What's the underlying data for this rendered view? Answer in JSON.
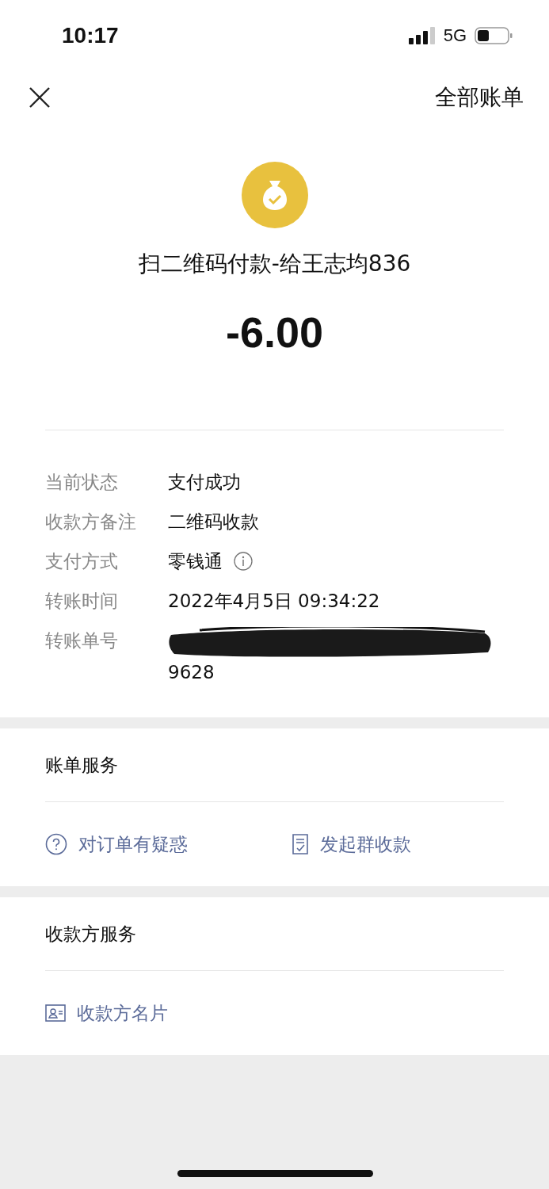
{
  "status_bar": {
    "time": "10:17",
    "network": "5G"
  },
  "nav": {
    "right_link": "全部账单"
  },
  "payment": {
    "title": "扫二维码付款-给王志均836",
    "amount": "-6.00"
  },
  "details": [
    {
      "label": "当前状态",
      "value": "支付成功",
      "kind": "text"
    },
    {
      "label": "收款方备注",
      "value": "二维码收款",
      "kind": "text"
    },
    {
      "label": "支付方式",
      "value": "零钱通",
      "kind": "info"
    },
    {
      "label": "转账时间",
      "value": "2022年4月5日 09:34:22",
      "kind": "text"
    },
    {
      "label": "转账单号",
      "value": "9628",
      "kind": "redacted"
    }
  ],
  "sections": [
    {
      "title": "账单服务",
      "actions": [
        {
          "label": "对订单有疑惑",
          "kind": "question"
        },
        {
          "label": "发起群收款",
          "kind": "checklist"
        }
      ]
    },
    {
      "title": "收款方服务",
      "actions": [
        {
          "label": "收款方名片",
          "kind": "card"
        }
      ]
    }
  ]
}
